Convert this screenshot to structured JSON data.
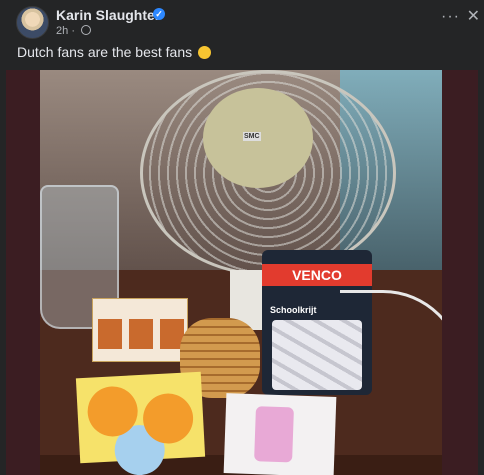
{
  "post": {
    "author": "Karin Slaughter",
    "verified": true,
    "timestamp": "2h",
    "privacy_icon": "globe-icon",
    "caption": "Dutch fans are the best fans",
    "caption_emoji": "smiling-face-emoji"
  },
  "header_actions": {
    "more_icon": "more-icon",
    "more_glyph": "···",
    "close_icon": "close-icon",
    "close_glyph": "✕",
    "dot": "·"
  },
  "photo": {
    "fan_label": "SMC",
    "venco_brand": "VENCO",
    "venco_product": "Schoolkrijt",
    "verified_glyph": "✓"
  },
  "colors": {
    "background": "#242526",
    "text": "#e4e6eb",
    "secondary_text": "#b0b3b8",
    "verified_badge": "#2d88ff",
    "photo_frame": "#3b1d22"
  }
}
